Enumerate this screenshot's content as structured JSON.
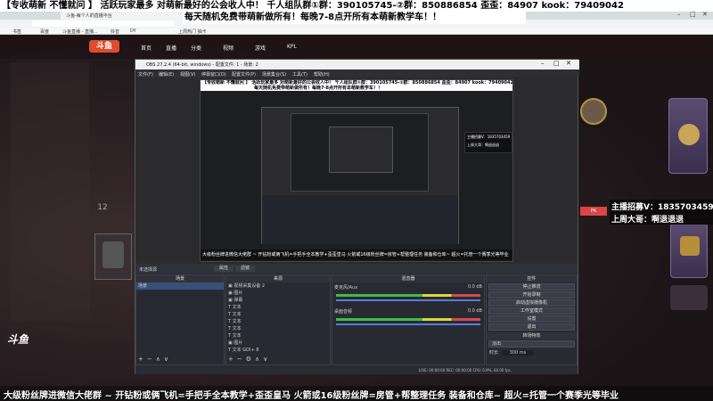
{
  "top_banner": {
    "line1": "【专收萌新 不懂就问 】 活跃玩家最多 对萌新最好的公会收人中！ 千人组队群①群：390105745-②群：850886854 歪歪：84907 kook：79409042",
    "line2": "每天随机免费带萌新做所有！每晚7-8点开所有本萌新教学车！！"
  },
  "browser": {
    "tab_title": "斗鱼-每个人的直播平台",
    "bookmarks": [
      "书签",
      "百度",
      "斗鱼直播 - 直播...",
      "抖音",
      "DY",
      "上周热门 抽卡"
    ],
    "site_nav": [
      "首页",
      "直播",
      "分类",
      "视频",
      "游戏",
      "KPL"
    ],
    "logo": "斗鱼"
  },
  "obs": {
    "title": "OBS 27.2.4 (64-bit, windows) - 配置文件: 1 - 场景: 2",
    "menu": [
      "文件(F)",
      "编辑(E)",
      "视图(V)",
      "停靠窗口(D)",
      "配置文件(P)",
      "场景集合(S)",
      "工具(T)",
      "帮助(H)"
    ],
    "source_label": "未选择源",
    "prop_btn": "属性",
    "filter_btn": "滤镜",
    "scenes_header": "场景",
    "scenes": [
      "场景"
    ],
    "sources_header": "来源",
    "sources": [
      "视频采集设备 2",
      "图片",
      "弹幕",
      "文本",
      "文本",
      "文本",
      "文本",
      "文本",
      "图片",
      "文本 GDI+ 8"
    ],
    "mixer_header": "混音器",
    "mixer_track1": "麦克风/Aux",
    "mixer_track1_db": "0.0 dB",
    "mixer_track2": "桌面音频",
    "mixer_track2_db": "0.0 dB",
    "controls_header": "控件",
    "controls": [
      "停止推流",
      "开始录制",
      "启动虚拟摄像机",
      "工作室模式",
      "设置",
      "退出"
    ],
    "transitions_header": "转场特效",
    "transition_value": "淡出",
    "duration_label": "时长",
    "duration_value": "300 ms",
    "status": "LIVE: 00:00:00   REC: 00:00:00   CPU: 6.9%, 60.00 fps"
  },
  "inner_text": {
    "ticker": "大级粉丝牌进微信大佬群 ~ 开钻粉或俩飞机=手把手全本教学+歪歪皇马   火箭或16级粉丝牌=房管+帮整理任务 装备和仓库~  超火=托管一个赛季光等毕业",
    "recruit": "主播招募V：1835703459",
    "hint": "上周大哥：啊退退退"
  },
  "left_panel": {
    "fans": "12"
  },
  "colors": {
    "banner_bg": "#ffffff",
    "banner_text": "#000000",
    "ticker_text": "#ffffff",
    "recruit_text": "#ffffff",
    "obs_bg": "#2b2b2e",
    "dock_bg": "#272a33",
    "purple_card": "#5a4c70"
  }
}
